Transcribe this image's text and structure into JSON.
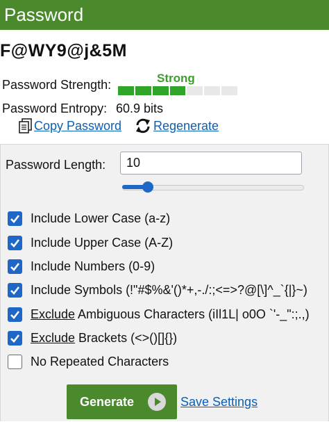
{
  "header": {
    "title": "Password"
  },
  "password": {
    "value": "F@WY9@j&5M"
  },
  "strength": {
    "label": "Password Strength:",
    "value": "Strong",
    "segments_total": 7,
    "segments_filled": 4,
    "color": "#2fa52a"
  },
  "entropy": {
    "label": "Password Entropy:",
    "value": "60.9 bits"
  },
  "links": {
    "copy": "Copy Password",
    "regenerate": "Regenerate"
  },
  "settings": {
    "length_label": "Password Length:",
    "length_value": "10",
    "slider_fraction": 0.14
  },
  "options": [
    {
      "label": "Include Lower Case (a-z)",
      "checked": true
    },
    {
      "label": "Include Upper Case (A-Z)",
      "checked": true
    },
    {
      "label": "Include Numbers (0-9)",
      "checked": true
    },
    {
      "label": "Include Symbols (!\"#$%&'()*+,-./:;<=>?@[\\]^_`{|}~)",
      "checked": true
    },
    {
      "prefix": "Exclude",
      "label": " Ambiguous Characters (iIl1L| o0O `'-_\":;.,)",
      "checked": true
    },
    {
      "prefix": "Exclude",
      "label": " Brackets (<>()[]{})",
      "checked": true
    },
    {
      "label": "No Repeated Characters",
      "checked": false
    }
  ],
  "buttons": {
    "generate": "Generate",
    "save": "Save Settings"
  },
  "colors": {
    "brand_green": "#4b8a2c",
    "accent_blue": "#1e67c7",
    "link_blue": "#0b5fb6"
  }
}
